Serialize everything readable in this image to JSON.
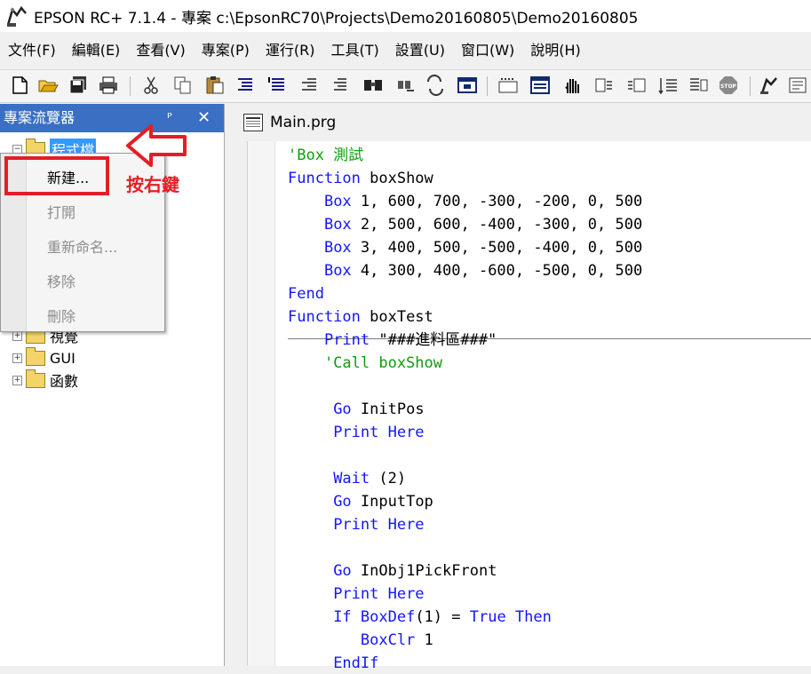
{
  "window": {
    "title": "EPSON RC+ 7.1.4 - 專案 c:\\EpsonRC70\\Projects\\Demo20160805\\Demo20160805"
  },
  "menu": [
    {
      "name": "menu-file",
      "label": "文件(F)"
    },
    {
      "name": "menu-edit",
      "label": "編輯(E)"
    },
    {
      "name": "menu-view",
      "label": "查看(V)"
    },
    {
      "name": "menu-project",
      "label": "專案(P)"
    },
    {
      "name": "menu-run",
      "label": "運行(R)"
    },
    {
      "name": "menu-tools",
      "label": "工具(T)"
    },
    {
      "name": "menu-setup",
      "label": "設置(U)"
    },
    {
      "name": "menu-window",
      "label": "窗口(W)"
    },
    {
      "name": "menu-help",
      "label": "說明(H)"
    }
  ],
  "toolbar_icons": [
    "new-file-icon",
    "open-folder-icon",
    "save-all-icon",
    "print-icon",
    "cut-icon",
    "copy-icon",
    "paste-icon",
    "indent-icon",
    "comment-icon",
    "outdent-icon",
    "uncomment-icon",
    "find-icon",
    "find-next-icon",
    "replace-icon",
    "window-icon",
    "io-monitor-icon",
    "task-manager-icon",
    "jog-hand-icon",
    "step-into-icon",
    "step-over-icon",
    "step-out-icon",
    "run-to-cursor-icon",
    "stop-icon",
    "robot-manager-icon",
    "build-icon"
  ],
  "project_panel": {
    "title": "專案流覽器",
    "pin": "ᴾ",
    "close": "✕",
    "tree": [
      {
        "name": "tree-item-programs",
        "label": "程式檔",
        "expanded": true,
        "selected": true
      },
      {
        "name": "tree-item-vision",
        "label": "視覺",
        "expanded": false
      },
      {
        "name": "tree-item-gui",
        "label": "GUI",
        "expanded": false
      },
      {
        "name": "tree-item-functions",
        "label": "函數",
        "expanded": false
      }
    ]
  },
  "context_menu": {
    "items": [
      {
        "name": "ctx-new",
        "label": "新建...",
        "enabled": true
      },
      {
        "name": "ctx-open",
        "label": "打開",
        "enabled": false
      },
      {
        "name": "ctx-rename",
        "label": "重新命名...",
        "enabled": false
      },
      {
        "name": "ctx-remove",
        "label": "移除",
        "enabled": false
      },
      {
        "name": "ctx-delete",
        "label": "刪除",
        "enabled": false
      }
    ]
  },
  "annotation": {
    "text": "按右鍵",
    "color": "#e31e24"
  },
  "editor": {
    "tab_label": "Main.prg",
    "lines": [
      [
        {
          "t": "'Box 測試",
          "c": "cm"
        }
      ],
      [
        {
          "t": "Function",
          "c": "kw"
        },
        {
          "t": " boxShow",
          "c": "tx"
        }
      ],
      [
        {
          "t": "    ",
          "c": "tx"
        },
        {
          "t": "Box",
          "c": "kw"
        },
        {
          "t": " 1, 600, 700, -300, -200, 0, 500",
          "c": "tx"
        }
      ],
      [
        {
          "t": "    ",
          "c": "tx"
        },
        {
          "t": "Box",
          "c": "kw"
        },
        {
          "t": " 2, 500, 600, -400, -300, 0, 500",
          "c": "tx"
        }
      ],
      [
        {
          "t": "    ",
          "c": "tx"
        },
        {
          "t": "Box",
          "c": "kw"
        },
        {
          "t": " 3, 400, 500, -500, -400, 0, 500",
          "c": "tx"
        }
      ],
      [
        {
          "t": "    ",
          "c": "tx"
        },
        {
          "t": "Box",
          "c": "kw"
        },
        {
          "t": " 4, 300, 400, -600, -500, 0, 500",
          "c": "tx"
        }
      ],
      [
        {
          "t": "Fend",
          "c": "kw"
        }
      ],
      [
        {
          "t": "Function",
          "c": "kw"
        },
        {
          "t": " boxTest",
          "c": "tx"
        }
      ],
      [
        {
          "t": "    ",
          "c": "tx"
        },
        {
          "t": "Print",
          "c": "kw"
        },
        {
          "t": " \"###進料區###\"",
          "c": "tx"
        }
      ],
      [
        {
          "t": "    'Call boxShow",
          "c": "cm"
        }
      ],
      [
        {
          "t": "",
          "c": "tx"
        }
      ],
      [
        {
          "t": "     ",
          "c": "tx"
        },
        {
          "t": "Go",
          "c": "kw"
        },
        {
          "t": " InitPos",
          "c": "tx"
        }
      ],
      [
        {
          "t": "     ",
          "c": "tx"
        },
        {
          "t": "Print Here",
          "c": "kw"
        }
      ],
      [
        {
          "t": "",
          "c": "tx"
        }
      ],
      [
        {
          "t": "     ",
          "c": "tx"
        },
        {
          "t": "Wait",
          "c": "kw"
        },
        {
          "t": " (2)",
          "c": "tx"
        }
      ],
      [
        {
          "t": "     ",
          "c": "tx"
        },
        {
          "t": "Go",
          "c": "kw"
        },
        {
          "t": " InputTop",
          "c": "tx"
        }
      ],
      [
        {
          "t": "     ",
          "c": "tx"
        },
        {
          "t": "Print Here",
          "c": "kw"
        }
      ],
      [
        {
          "t": "",
          "c": "tx"
        }
      ],
      [
        {
          "t": "     ",
          "c": "tx"
        },
        {
          "t": "Go",
          "c": "kw"
        },
        {
          "t": " InObj1PickFront",
          "c": "tx"
        }
      ],
      [
        {
          "t": "     ",
          "c": "tx"
        },
        {
          "t": "Print Here",
          "c": "kw"
        }
      ],
      [
        {
          "t": "     ",
          "c": "tx"
        },
        {
          "t": "If BoxDef",
          "c": "kw"
        },
        {
          "t": "(1) = ",
          "c": "tx"
        },
        {
          "t": "True Then",
          "c": "kw"
        }
      ],
      [
        {
          "t": "        BoxClr",
          "c": "kw"
        },
        {
          "t": " 1",
          "c": "tx"
        }
      ],
      [
        {
          "t": "     ",
          "c": "tx"
        },
        {
          "t": "EndIf",
          "c": "kw"
        }
      ]
    ]
  }
}
